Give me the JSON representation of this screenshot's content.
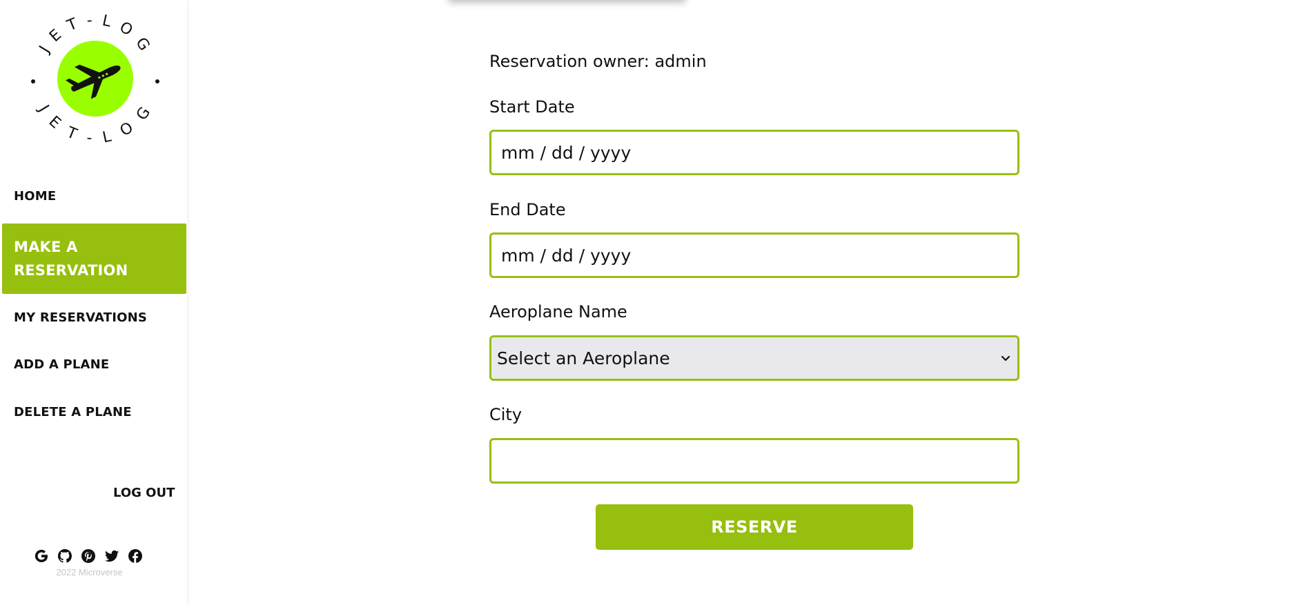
{
  "brand": {
    "ring_text_top": "J E T - L O G",
    "ring_text_bottom": "J E T - L O G",
    "badge_color": "#99ff00",
    "accent_color": "#97bf0f"
  },
  "sidebar": {
    "items": [
      {
        "label": "Home"
      },
      {
        "label": "Make a Reservation",
        "lines": [
          "MAKE A",
          "RESERVATION"
        ],
        "active": true
      },
      {
        "label": "My Reservations"
      },
      {
        "label": "Add a Plane"
      },
      {
        "label": "Delete a Plane"
      }
    ],
    "logout_label": "Log Out",
    "socials": [
      "google-icon",
      "github-icon",
      "pinterest-icon",
      "twitter-icon",
      "facebook-icon"
    ],
    "footer": "2022 Microverse"
  },
  "form": {
    "owner_text": "Reservation owner: admin",
    "start_date_label": "Start Date",
    "start_date_placeholder": "mm / dd / yyyy",
    "end_date_label": "End Date",
    "end_date_placeholder": "mm / dd / yyyy",
    "aeroplane_label": "Aeroplane Name",
    "aeroplane_selected": "Select an Aeroplane",
    "city_label": "City",
    "city_value": "",
    "submit_label": "Reserve"
  }
}
